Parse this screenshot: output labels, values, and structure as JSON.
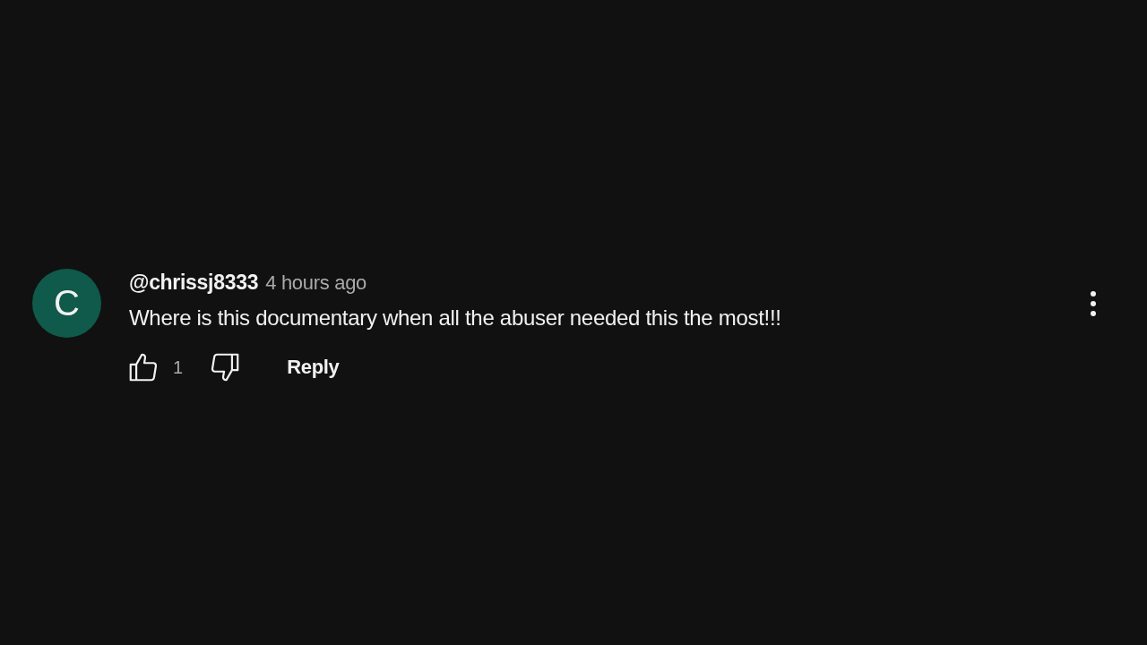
{
  "comment": {
    "avatar_letter": "C",
    "author": "@chrissj8333",
    "time": "4 hours ago",
    "text": "Where is this documentary when all the abuser needed this the most!!!",
    "like_count": "1",
    "reply_label": "Reply"
  }
}
